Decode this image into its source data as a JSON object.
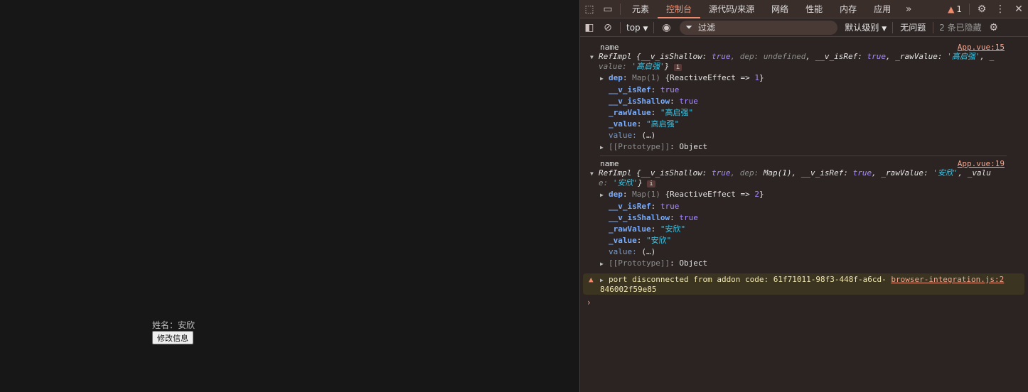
{
  "page": {
    "name_label": "姓名：安欣",
    "edit_button": "修改信息"
  },
  "devtools": {
    "tabs": [
      "元素",
      "控制台",
      "源代码/来源",
      "网络",
      "性能",
      "内存",
      "应用"
    ],
    "active_tab": "控制台",
    "warning_count": "1",
    "context": "top",
    "filter_placeholder": "过滤",
    "level": "默认级别",
    "issues": "无问题",
    "hidden": "2 条已隐藏",
    "logs": [
      {
        "label": "name",
        "source": "App.vue:15",
        "summary_prefix": "RefImpl {__v_isShallow: ",
        "t": "true",
        "dep_part": ", dep: ",
        "dep_val": "undefined",
        "isref": ", __v_isRef: ",
        "raw": ", _rawValue: ",
        "raw_val": "'高启强'",
        "rest": ", _",
        "line2_a": "value: ",
        "line2_val": "'高启强'",
        "line2_b": "}",
        "props": {
          "dep_key": "dep",
          "dep_val": "Map(1) ",
          "dep_rest": "{ReactiveEffect => ",
          "dep_n": "1",
          "dep_end": "}",
          "isref_key": "__v_isRef",
          "isshallow_key": "__v_isShallow",
          "true": "true",
          "raw_key": "_rawValue",
          "raw_val": "\"高启强\"",
          "val_key": "_value",
          "val_val": "\"高启强\"",
          "getter": "value: ",
          "getter_val": "(…)",
          "proto": "[[Prototype]]",
          "proto_val": "Object"
        }
      },
      {
        "label": "name",
        "source": "App.vue:19",
        "summary_prefix": "RefImpl {__v_isShallow: ",
        "t": "true",
        "dep_part": ", dep: ",
        "dep_val": "Map(1)",
        "isref": ", __v_isRef: ",
        "raw": ", _rawValue: ",
        "raw_val": "'安欣'",
        "rest": ", _valu",
        "line2_a": "e: ",
        "line2_val": "'安欣'",
        "line2_b": "}",
        "props": {
          "dep_key": "dep",
          "dep_val": "Map(1) ",
          "dep_rest": "{ReactiveEffect => ",
          "dep_n": "2",
          "dep_end": "}",
          "isref_key": "__v_isRef",
          "isshallow_key": "__v_isShallow",
          "true": "true",
          "raw_key": "_rawValue",
          "raw_val": "\"安欣\"",
          "val_key": "_value",
          "val_val": "\"安欣\"",
          "getter": "value: ",
          "getter_val": "(…)",
          "proto": "[[Prototype]]",
          "proto_val": "Object"
        }
      }
    ],
    "warning": {
      "text": "port disconnected from addon code: 61f71011-98f3-448f-a6cd-",
      "text2": "846002f59e85",
      "source": "browser-integration.js:2"
    }
  }
}
